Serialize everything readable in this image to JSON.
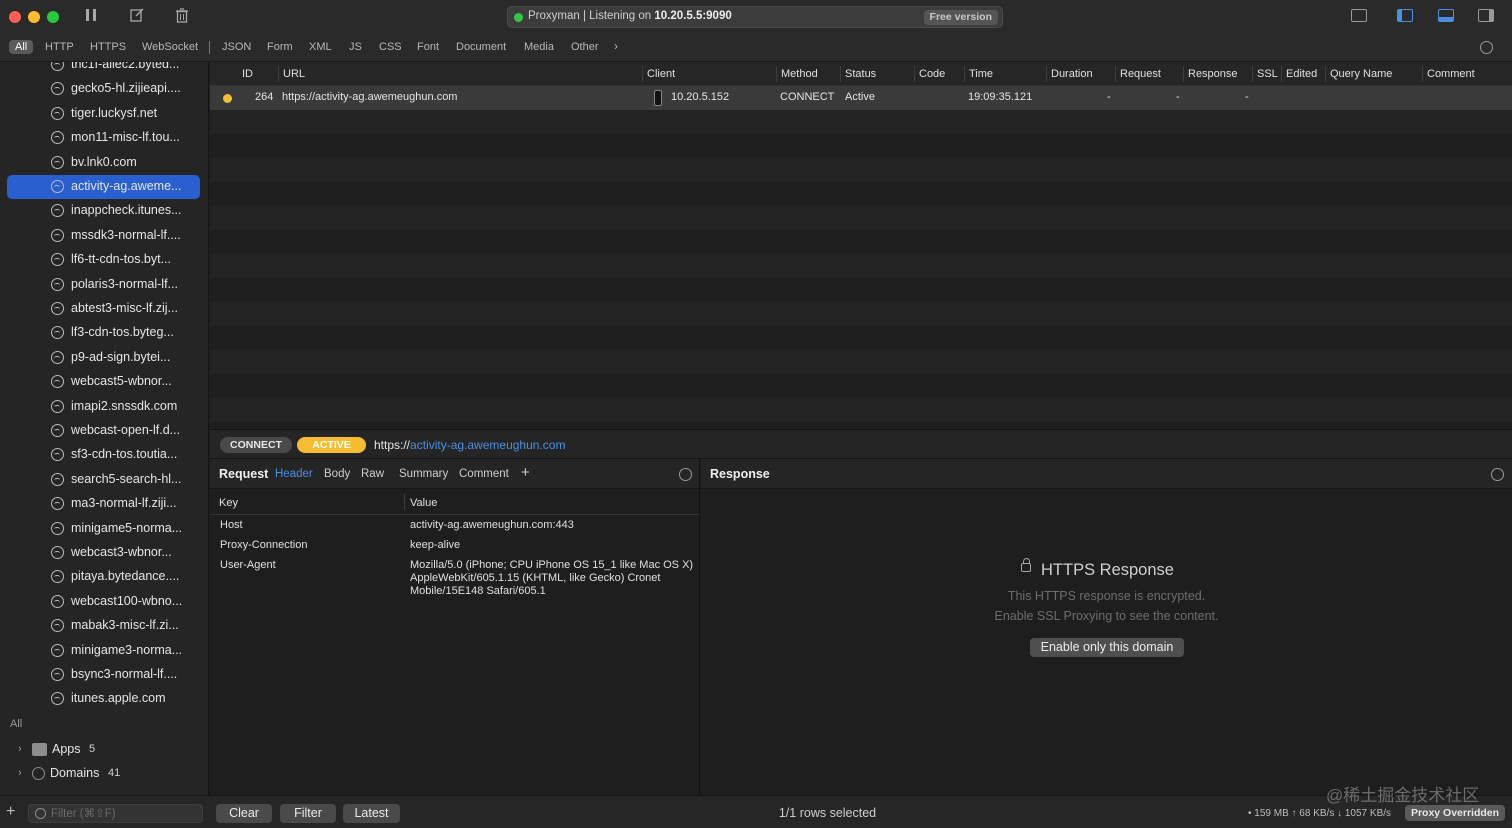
{
  "titlebar": {
    "status_text_prefix": "Proxyman | Listening on ",
    "status_address": "10.20.5.5:9090",
    "free_badge": "Free version"
  },
  "filter_tabs": [
    "All",
    "HTTP",
    "HTTPS",
    "WebSocket",
    "JSON",
    "Form",
    "XML",
    "JS",
    "CSS",
    "Font",
    "Document",
    "Media",
    "Other"
  ],
  "sidebar": {
    "items": [
      "tnc1f-aliec2.byted...",
      "gecko5-hl.zijieapi....",
      "tiger.luckysf.net",
      "mon11-misc-lf.tou...",
      "bv.lnk0.com",
      "activity-ag.aweme...",
      "inappcheck.itunes...",
      "mssdk3-normal-lf....",
      "lf6-tt-cdn-tos.byt...",
      "polaris3-normal-lf...",
      "abtest3-misc-lf.zij...",
      "lf3-cdn-tos.byteg...",
      "p9-ad-sign.bytei...",
      "webcast5-wbnor...",
      "imapi2.snssdk.com",
      "webcast-open-lf.d...",
      "sf3-cdn-tos.toutia...",
      "search5-search-hl...",
      "ma3-normal-lf.ziji...",
      "minigame5-norma...",
      "webcast3-wbnor...",
      "pitaya.bytedance....",
      "webcast100-wbno...",
      "mabak3-misc-lf.zi...",
      "minigame3-norma...",
      "bsync3-normal-lf....",
      "itunes.apple.com"
    ],
    "selected_index": 5,
    "section_label": "All",
    "groups": [
      {
        "label": "Apps",
        "count": "5"
      },
      {
        "label": "Domains",
        "count": "41"
      }
    ]
  },
  "table": {
    "columns": [
      "ID",
      "URL",
      "Client",
      "Method",
      "Status",
      "Code",
      "Time",
      "Duration",
      "Request",
      "Response",
      "SSL",
      "Edited",
      "Query Name",
      "Comment"
    ],
    "rows": [
      {
        "id": "264",
        "url": "https://activity-ag.awemeughun.com",
        "client": "10.20.5.152",
        "method": "CONNECT",
        "status": "Active",
        "code": "",
        "time": "19:09:35.121",
        "duration": "-",
        "request": "-",
        "response": "-"
      }
    ]
  },
  "detail": {
    "method_pill": "CONNECT",
    "status_pill": "ACTIVE",
    "url_scheme": "https://",
    "url_host": "activity-ag.awemeughun.com"
  },
  "request_pane": {
    "title": "Request",
    "tabs": [
      "Header",
      "Body",
      "Raw",
      "Summary",
      "Comment"
    ],
    "add_tab": "+",
    "key_header": "Key",
    "value_header": "Value",
    "headers": [
      {
        "key": "Host",
        "value": "activity-ag.awemeughun.com:443"
      },
      {
        "key": "Proxy-Connection",
        "value": "keep-alive"
      },
      {
        "key": "User-Agent",
        "value": "Mozilla/5.0 (iPhone; CPU iPhone OS 15_1 like Mac OS X) AppleWebKit/605.1.15 (KHTML, like Gecko) Cronet Mobile/15E148 Safari/605.1"
      }
    ]
  },
  "response_pane": {
    "title": "Response",
    "heading": "HTTPS Response",
    "line1": "This HTTPS response is encrypted.",
    "line2": "Enable SSL Proxying to see the content.",
    "button": "Enable only this domain"
  },
  "bottombar": {
    "filter_placeholder": "Filter (⌘⇧F)",
    "clear": "Clear",
    "filter": "Filter",
    "latest": "Latest",
    "rows_selected": "1/1 rows selected",
    "traffic": "• 159 MB ↑ 68 KB/s ↓ 1057 KB/s",
    "proxy_badge": "Proxy Overridden"
  },
  "watermark": "@稀土掘金技术社区",
  "colors": {
    "accent": "#2a5fcf",
    "link": "#4a90e2",
    "active": "#f5bd31",
    "listening": "#33c748"
  }
}
